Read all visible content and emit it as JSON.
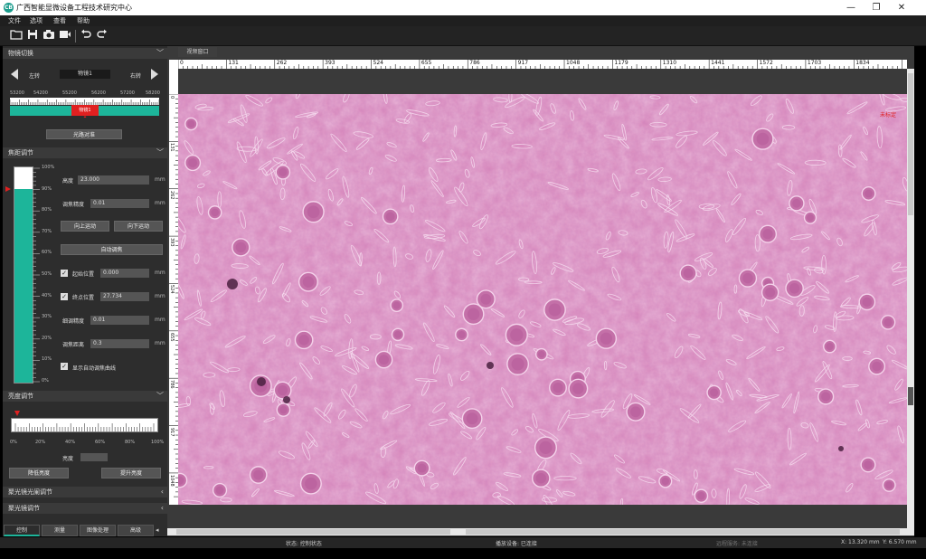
{
  "window": {
    "app_icon_text": "CB",
    "title": "广西智能显微设备工程技术研究中心",
    "controls": [
      "—",
      "❐",
      "✕"
    ]
  },
  "menu": [
    "文件",
    "选项",
    "查看",
    "帮助"
  ],
  "toolbar": [
    "open-folder-icon",
    "save-icon",
    "camera-icon",
    "video-icon",
    "undo-icon",
    "redo-icon"
  ],
  "objective": {
    "header": "物镜切换",
    "left_label": "左转",
    "right_label": "右转",
    "current": "物镜1",
    "scale_labels": [
      "53200",
      "54200",
      "55200",
      "56200",
      "57200",
      "58200"
    ],
    "marker": "物镜1",
    "align_button": "光路对准"
  },
  "focus": {
    "header": "焦距调节",
    "scale_labels": [
      "100%",
      "90%",
      "80%",
      "70%",
      "60%",
      "50%",
      "40%",
      "30%",
      "20%",
      "10%",
      "0%"
    ],
    "fill_percent": 90,
    "height_label": "高度",
    "height_value": "23.000",
    "height_unit": "mm",
    "precision_label": "调焦精度",
    "precision_value": "0.01",
    "precision_unit": "mm",
    "up_button": "向上运动",
    "down_button": "向下运动",
    "auto_button": "自动调焦",
    "start_label": "起始位置",
    "start_value": "0.000",
    "start_unit": "mm",
    "end_label": "终点位置",
    "end_value": "27.734",
    "end_unit": "mm",
    "fine_label": "细调精度",
    "fine_value": "0.01",
    "fine_unit": "mm",
    "distance_label": "调焦距离",
    "distance_value": "0.3",
    "distance_unit": "mm",
    "curve_label": "显示自动调焦曲线"
  },
  "brightness": {
    "header": "亮度调节",
    "scale_labels": [
      "0%",
      "20%",
      "40%",
      "60%",
      "80%",
      "100%"
    ],
    "level_percent": 0,
    "label": "亮度",
    "value": "",
    "down_button": "降低亮度",
    "up_button": "提升亮度"
  },
  "collapsed_sections": [
    "聚光镜光阑调节",
    "聚光镜调节"
  ],
  "bottom_tabs": [
    "控制",
    "测量",
    "图像处理",
    "高级"
  ],
  "video": {
    "tab": "视频窗口",
    "h_ruler": [
      "0",
      "131",
      "262",
      "393",
      "524",
      "655",
      "786",
      "917",
      "1048",
      "1179",
      "1310",
      "1441",
      "1572",
      "1703",
      "1834"
    ],
    "v_ruler": [
      "0",
      "131",
      "262",
      "393",
      "524",
      "655",
      "786",
      "917",
      "1048"
    ],
    "overlay_text": "未标定"
  },
  "status": {
    "state": "状态: 控制状态",
    "device": "播放设备: 已连接",
    "server": "远程服务: 未连接",
    "x": "X: 13.320 mm",
    "y": "Y: 6.570 mm"
  },
  "colors": {
    "accent": "#1db59a",
    "marker_red": "#e02020",
    "panel": "#2d2d2d",
    "tissue": "#d884b8"
  }
}
